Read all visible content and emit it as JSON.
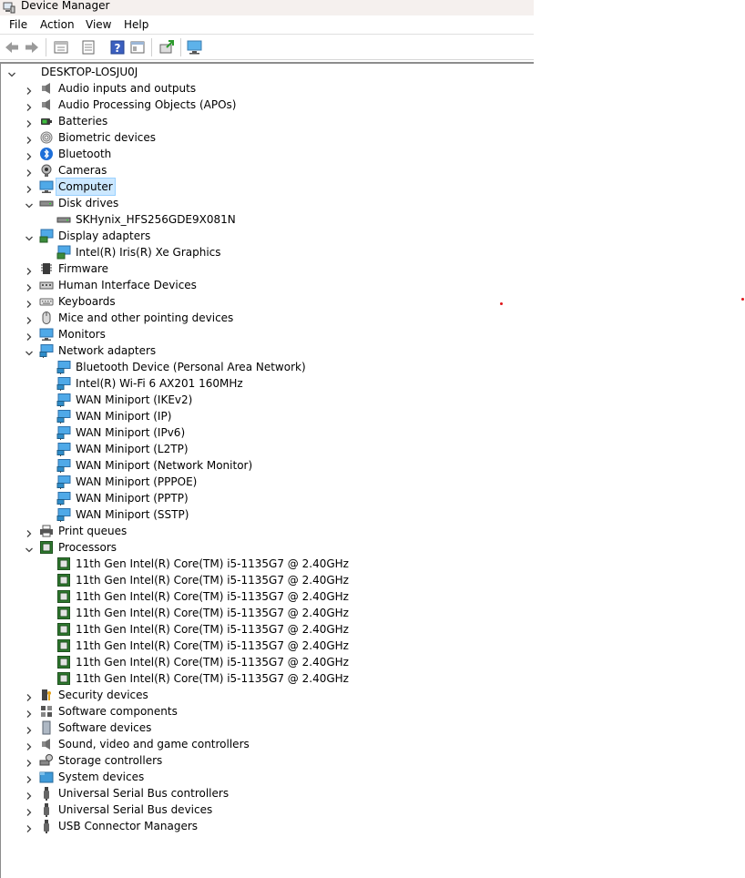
{
  "window": {
    "title": "Device Manager"
  },
  "menu": [
    "File",
    "Action",
    "View",
    "Help"
  ],
  "toolbar": {
    "buttons": [
      "back-icon",
      "forward-icon",
      "properties-icon",
      "show-hide-tree-icon",
      "help-icon",
      "view-icon",
      "update-driver-icon",
      "scan-hardware-icon"
    ]
  },
  "tree": {
    "root": "DESKTOP-LOSJU0J",
    "nodes": [
      {
        "label": "Audio inputs and outputs",
        "icon": "speaker-icon",
        "expanded": false
      },
      {
        "label": "Audio Processing Objects (APOs)",
        "icon": "speaker-icon",
        "expanded": false
      },
      {
        "label": "Batteries",
        "icon": "battery-icon",
        "expanded": false
      },
      {
        "label": "Biometric devices",
        "icon": "fingerprint-icon",
        "expanded": false
      },
      {
        "label": "Bluetooth",
        "icon": "bluetooth-icon",
        "expanded": false
      },
      {
        "label": "Cameras",
        "icon": "camera-icon",
        "expanded": false
      },
      {
        "label": "Computer",
        "icon": "monitor-icon",
        "expanded": false,
        "selected": true
      },
      {
        "label": "Disk drives",
        "icon": "disk-drive-icon",
        "expanded": true,
        "children": [
          {
            "label": "SKHynix_HFS256GDE9X081N",
            "icon": "disk-drive-icon"
          }
        ]
      },
      {
        "label": "Display adapters",
        "icon": "display-adapter-icon",
        "expanded": true,
        "children": [
          {
            "label": "Intel(R) Iris(R) Xe Graphics",
            "icon": "display-adapter-icon"
          }
        ]
      },
      {
        "label": "Firmware",
        "icon": "chip-icon",
        "expanded": false
      },
      {
        "label": "Human Interface Devices",
        "icon": "hid-icon",
        "expanded": false
      },
      {
        "label": "Keyboards",
        "icon": "keyboard-icon",
        "expanded": false
      },
      {
        "label": "Mice and other pointing devices",
        "icon": "mouse-icon",
        "expanded": false
      },
      {
        "label": "Monitors",
        "icon": "monitor-icon",
        "expanded": false
      },
      {
        "label": "Network adapters",
        "icon": "network-adapter-icon",
        "expanded": true,
        "children": [
          {
            "label": "Bluetooth Device (Personal Area Network)",
            "icon": "network-adapter-icon"
          },
          {
            "label": "Intel(R) Wi-Fi 6 AX201 160MHz",
            "icon": "network-adapter-icon"
          },
          {
            "label": "WAN Miniport (IKEv2)",
            "icon": "network-adapter-icon"
          },
          {
            "label": "WAN Miniport (IP)",
            "icon": "network-adapter-icon"
          },
          {
            "label": "WAN Miniport (IPv6)",
            "icon": "network-adapter-icon"
          },
          {
            "label": "WAN Miniport (L2TP)",
            "icon": "network-adapter-icon"
          },
          {
            "label": "WAN Miniport (Network Monitor)",
            "icon": "network-adapter-icon"
          },
          {
            "label": "WAN Miniport (PPPOE)",
            "icon": "network-adapter-icon"
          },
          {
            "label": "WAN Miniport (PPTP)",
            "icon": "network-adapter-icon"
          },
          {
            "label": "WAN Miniport (SSTP)",
            "icon": "network-adapter-icon"
          }
        ]
      },
      {
        "label": "Print queues",
        "icon": "printer-icon",
        "expanded": false
      },
      {
        "label": "Processors",
        "icon": "processor-icon",
        "expanded": true,
        "children": [
          {
            "label": "11th Gen Intel(R) Core(TM) i5-1135G7 @ 2.40GHz",
            "icon": "processor-icon"
          },
          {
            "label": "11th Gen Intel(R) Core(TM) i5-1135G7 @ 2.40GHz",
            "icon": "processor-icon"
          },
          {
            "label": "11th Gen Intel(R) Core(TM) i5-1135G7 @ 2.40GHz",
            "icon": "processor-icon"
          },
          {
            "label": "11th Gen Intel(R) Core(TM) i5-1135G7 @ 2.40GHz",
            "icon": "processor-icon"
          },
          {
            "label": "11th Gen Intel(R) Core(TM) i5-1135G7 @ 2.40GHz",
            "icon": "processor-icon"
          },
          {
            "label": "11th Gen Intel(R) Core(TM) i5-1135G7 @ 2.40GHz",
            "icon": "processor-icon"
          },
          {
            "label": "11th Gen Intel(R) Core(TM) i5-1135G7 @ 2.40GHz",
            "icon": "processor-icon"
          },
          {
            "label": "11th Gen Intel(R) Core(TM) i5-1135G7 @ 2.40GHz",
            "icon": "processor-icon"
          }
        ]
      },
      {
        "label": "Security devices",
        "icon": "security-icon",
        "expanded": false
      },
      {
        "label": "Software components",
        "icon": "puzzle-icon",
        "expanded": false
      },
      {
        "label": "Software devices",
        "icon": "software-device-icon",
        "expanded": false
      },
      {
        "label": "Sound, video and game controllers",
        "icon": "speaker-icon",
        "expanded": false
      },
      {
        "label": "Storage controllers",
        "icon": "storage-controller-icon",
        "expanded": false
      },
      {
        "label": "System devices",
        "icon": "folder-icon",
        "expanded": false
      },
      {
        "label": "Universal Serial Bus controllers",
        "icon": "usb-icon",
        "expanded": false
      },
      {
        "label": "Universal Serial Bus devices",
        "icon": "usb-icon",
        "expanded": false
      },
      {
        "label": "USB Connector Managers",
        "icon": "usb-icon",
        "expanded": false
      }
    ]
  },
  "colors": {
    "selection_bg": "#cce8ff",
    "selection_border": "#99d1ff",
    "titlebar_bg": "#f5f0ee",
    "accent_blue": "#1e90d8"
  }
}
